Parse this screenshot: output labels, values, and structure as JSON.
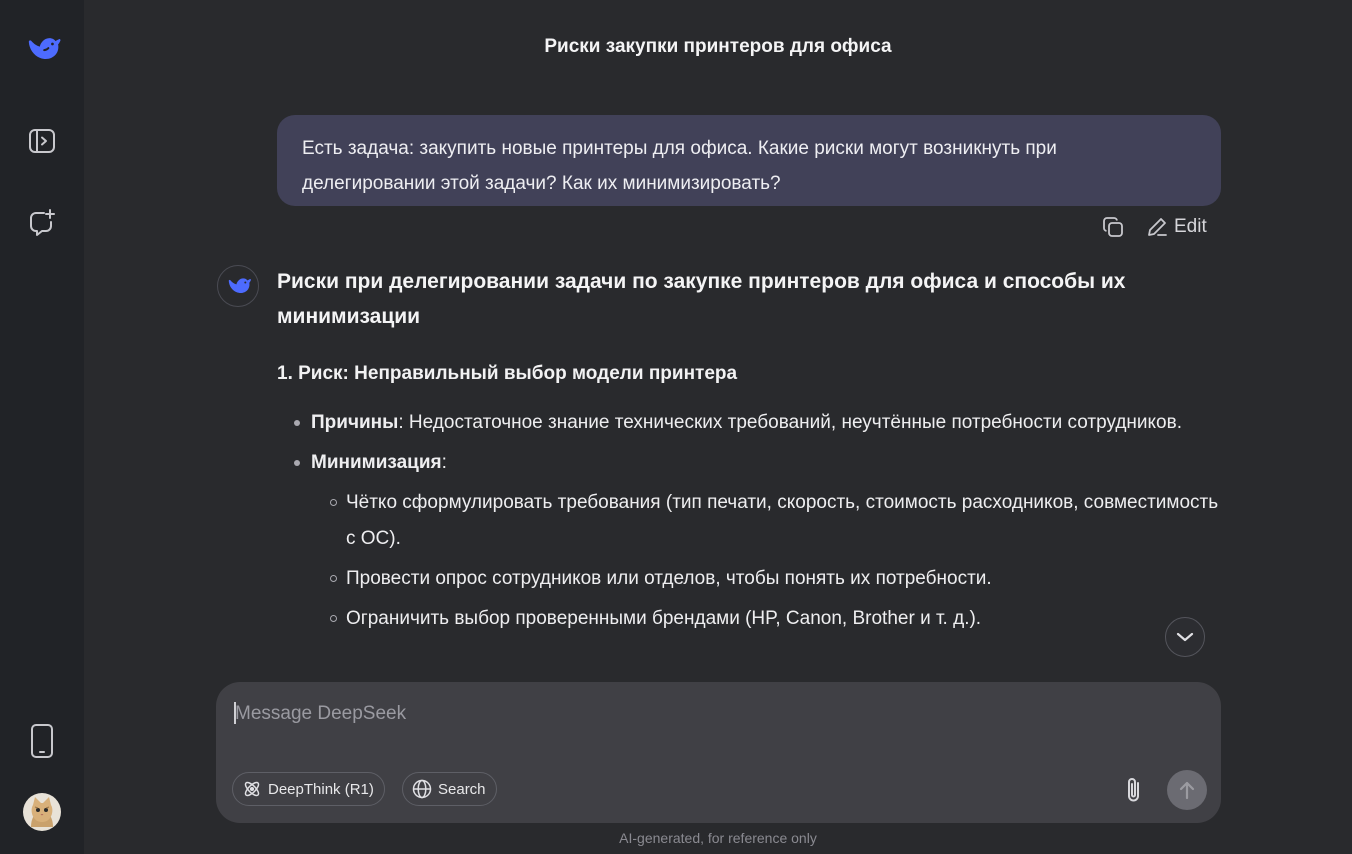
{
  "header": {
    "title": "Риски закупки принтеров для офиса"
  },
  "sidebar": {
    "icons": [
      "deepseek-logo-icon",
      "sidebar-toggle-icon",
      "new-chat-icon",
      "mobile-app-icon",
      "avatar"
    ]
  },
  "user_message": {
    "text": "Есть задача: закупить новые принтеры для офиса. Какие риски могут возникнуть при делегировании этой задачи? Как их минимизировать?",
    "edit_label": "Edit"
  },
  "answer": {
    "heading": "Риски при делегировании задачи по закупке принтеров для офиса и способы их минимизации",
    "section1_title": "1. Риск: Неправильный выбор модели принтера",
    "causes_label": "Причины",
    "causes_text": ": Недостаточное знание технических требований, неучтённые потребности сотрудников.",
    "mitigation_label": "Минимизация",
    "mitigation_colon": ":",
    "mitigation_items": [
      "Чётко сформулировать требования (тип печати, скорость, стоимость расходников, совместимость с ОС).",
      "Провести опрос сотрудников или отделов, чтобы понять их потребности.",
      "Ограничить выбор проверенными брендами (HP, Canon, Brother и т. д.)."
    ]
  },
  "composer": {
    "placeholder": "Message DeepSeek",
    "deepthink_label": "DeepThink (R1)",
    "search_label": "Search"
  },
  "footer": {
    "note": "AI-generated, for reference only"
  },
  "colors": {
    "accent": "#4d6bfe",
    "background": "#292a2d",
    "sidebar": "#212327",
    "user_bubble": "#414158",
    "composer": "#404045"
  }
}
